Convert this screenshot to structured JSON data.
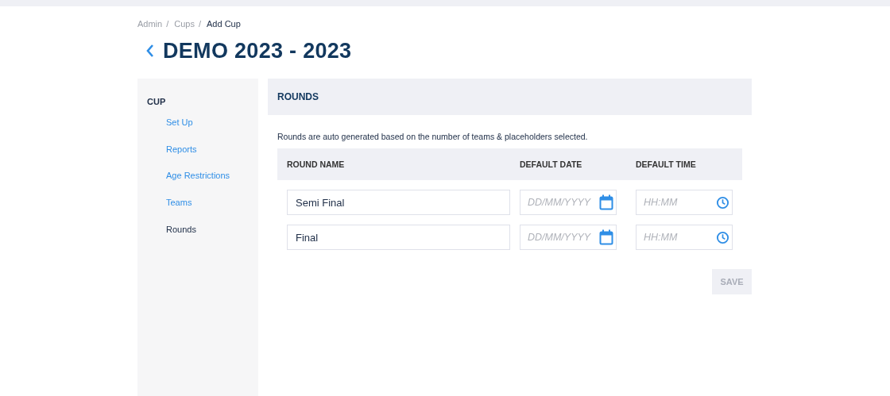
{
  "breadcrumb": [
    {
      "label": "Admin",
      "current": false
    },
    {
      "label": "Cups",
      "current": false
    },
    {
      "label": "Add Cup",
      "current": true
    }
  ],
  "breadcrumb_separator": "/",
  "title": "DEMO 2023 - 2023",
  "sidebar": {
    "heading": "CUP",
    "items": [
      {
        "label": "Set Up",
        "selected": false
      },
      {
        "label": "Reports",
        "selected": false
      },
      {
        "label": "Age Restrictions",
        "selected": false
      },
      {
        "label": "Teams",
        "selected": false
      },
      {
        "label": "Rounds",
        "selected": true
      }
    ]
  },
  "panel": {
    "title": "ROUNDS",
    "description": "Rounds are auto generated based on the number of teams & placeholders selected.",
    "columns": [
      "ROUND NAME",
      "DEFAULT DATE",
      "DEFAULT TIME"
    ],
    "rows": [
      {
        "name": "Semi Final",
        "date_placeholder": "DD/MM/YYYY",
        "time_placeholder": "HH:MM"
      },
      {
        "name": "Final",
        "date_placeholder": "DD/MM/YYYY",
        "time_placeholder": "HH:MM"
      }
    ],
    "save": {
      "label": "SAVE",
      "disabled": true
    }
  }
}
